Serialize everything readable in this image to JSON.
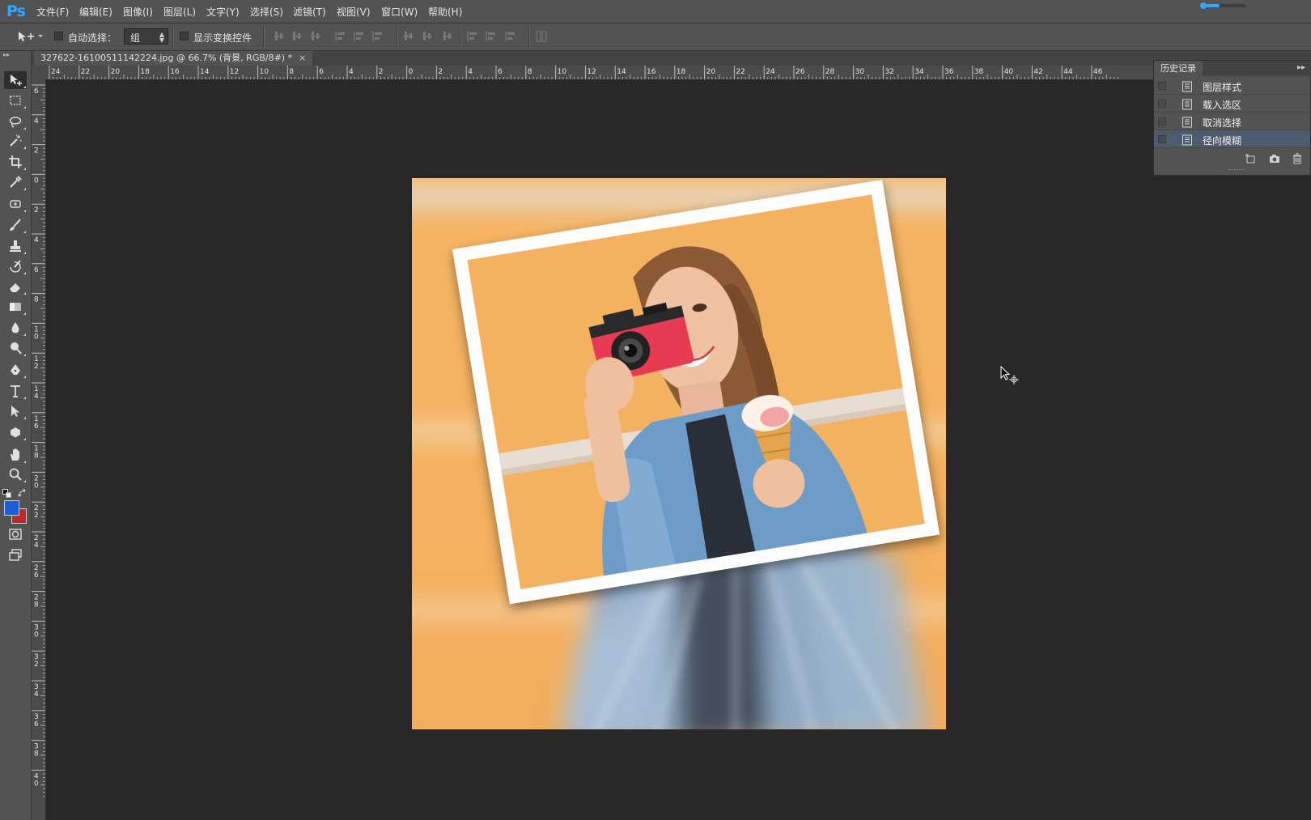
{
  "app": {
    "logo": "Ps"
  },
  "menu": [
    {
      "label": "文件(F)"
    },
    {
      "label": "编辑(E)"
    },
    {
      "label": "图像(I)"
    },
    {
      "label": "图层(L)"
    },
    {
      "label": "文字(Y)"
    },
    {
      "label": "选择(S)"
    },
    {
      "label": "滤镜(T)"
    },
    {
      "label": "视图(V)"
    },
    {
      "label": "窗口(W)"
    },
    {
      "label": "帮助(H)"
    }
  ],
  "options": {
    "auto_select_label": "自动选择：",
    "auto_select_checked": false,
    "group_value": "组",
    "show_transform_label": "显示变换控件",
    "show_transform_checked": false
  },
  "document": {
    "tab_title": "327622-16100511142224.jpg @ 66.7% (背景, RGB/8#) *",
    "close_glyph": "×"
  },
  "rulers": {
    "top_labels": [
      "24",
      "22",
      "20",
      "18",
      "16",
      "14",
      "12",
      "10",
      "8",
      "6",
      "4",
      "2",
      "0",
      "2",
      "4",
      "6",
      "8",
      "10",
      "12",
      "14",
      "16",
      "18",
      "20",
      "22",
      "24",
      "26",
      "28",
      "30",
      "32",
      "34",
      "36",
      "38",
      "40",
      "42",
      "44",
      "46"
    ],
    "left_labels": [
      "6",
      "4",
      "2",
      "0",
      "2",
      "4",
      "6",
      "8",
      "1\n0",
      "1\n2",
      "1\n4",
      "1\n6",
      "1\n8",
      "2\n0",
      "2\n2",
      "2\n4",
      "2\n6",
      "2\n8",
      "3\n0",
      "3\n2",
      "3\n4",
      "3\n6",
      "3\n8",
      "4\n0"
    ]
  },
  "history": {
    "tab_label": "历史记录",
    "menu_glyph": "▸▸",
    "items": [
      {
        "label": "图层样式",
        "selected": false
      },
      {
        "label": "载入选区",
        "selected": false
      },
      {
        "label": "取消选择",
        "selected": false
      },
      {
        "label": "径向模糊",
        "selected": true
      }
    ]
  },
  "colors": {
    "foreground": "#1a5fd6",
    "background": "#c0282d",
    "accent": "#31a8ff"
  },
  "tools": [
    "move-tool-icon",
    "marquee-tool-icon",
    "lasso-tool-icon",
    "magic-wand-icon",
    "crop-tool-icon",
    "eyedropper-icon",
    "healing-brush-icon",
    "brush-tool-icon",
    "clone-stamp-icon",
    "history-brush-icon",
    "eraser-icon",
    "gradient-tool-icon",
    "blur-tool-icon",
    "dodge-tool-icon",
    "pen-tool-icon",
    "type-tool-icon",
    "path-selection-icon",
    "shape-tool-icon",
    "hand-tool-icon",
    "zoom-tool-icon"
  ]
}
